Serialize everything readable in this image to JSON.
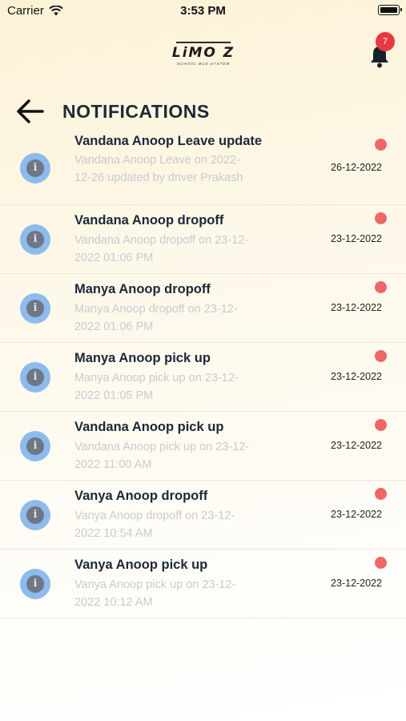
{
  "status_bar": {
    "carrier": "Carrier",
    "time": "3:53 PM"
  },
  "header": {
    "logo_text": "LiMO Z",
    "logo_tagline": "SCHOOL BUS SYSTEM",
    "notification_count": "7",
    "title": "NOTIFICATIONS"
  },
  "colors": {
    "unread_dot": "#ee6768",
    "badge": "#e63a43",
    "info_icon_bg": "#8ebbed"
  },
  "notifications": [
    {
      "title": "Vandana Anoop Leave update",
      "body": "Vandana Anoop Leave on 2022-12-26 updated by driver Prakash",
      "date": "26-12-2022",
      "icon": "info-icon"
    },
    {
      "title": "Vandana Anoop dropoff",
      "body": "Vandana Anoop dropoff on 23-12-2022 01:06 PM",
      "date": "23-12-2022",
      "icon": "info-icon"
    },
    {
      "title": "Manya Anoop dropoff",
      "body": "Manya Anoop dropoff on 23-12-2022 01:06 PM",
      "date": "23-12-2022",
      "icon": "info-icon"
    },
    {
      "title": "Manya Anoop pick up",
      "body": "Manya Anoop pick up on 23-12-2022 01:05 PM",
      "date": "23-12-2022",
      "icon": "info-icon"
    },
    {
      "title": "Vandana Anoop pick up",
      "body": "Vandana Anoop pick up on 23-12-2022 11:00 AM",
      "date": "23-12-2022",
      "icon": "info-icon"
    },
    {
      "title": "Vanya Anoop dropoff",
      "body": "Vanya Anoop dropoff on 23-12-2022 10:54 AM",
      "date": "23-12-2022",
      "icon": "info-icon"
    },
    {
      "title": "Vanya Anoop pick up",
      "body": "Vanya Anoop pick up on 23-12-2022 10:12 AM",
      "date": "23-12-2022",
      "icon": "info-icon"
    }
  ]
}
